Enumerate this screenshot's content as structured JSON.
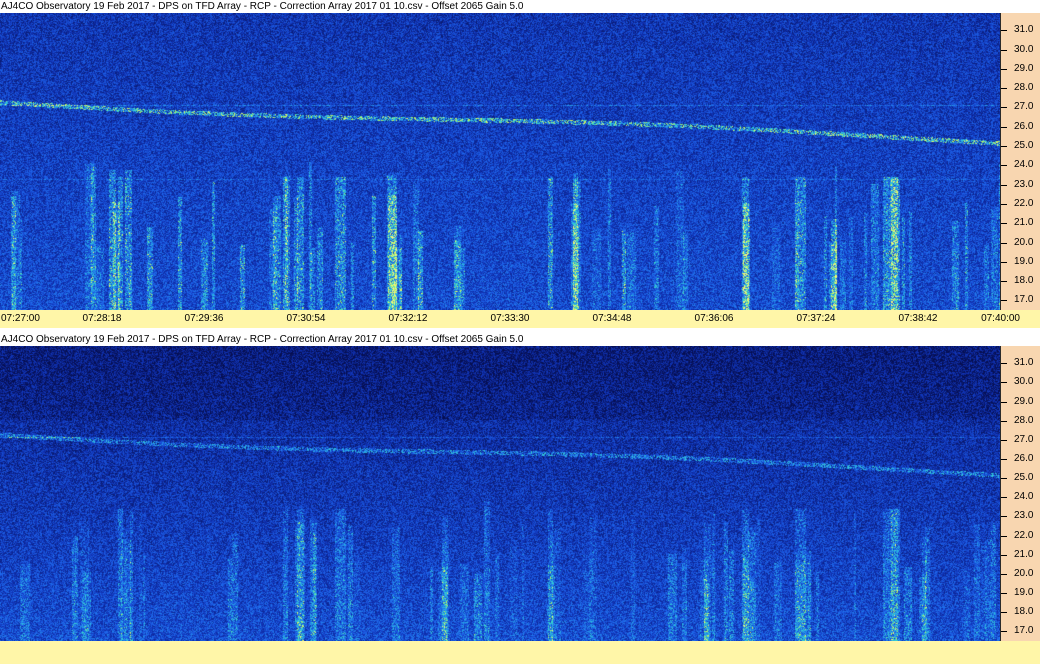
{
  "chart_data": [
    {
      "type": "heatmap",
      "title": "AJ4CO Observatory 19 Feb 2017  -  DPS on TFD Array  -  RCP  -  Correction Array 2017 01 10.csv  -  Offset 2065  Gain 5.0",
      "y_ticks": [
        "31.0",
        "30.0",
        "29.0",
        "28.0",
        "27.0",
        "26.0",
        "25.0",
        "24.0",
        "23.0",
        "22.0",
        "21.0",
        "20.0",
        "19.0",
        "18.0",
        "17.0"
      ],
      "ylim": [
        16.5,
        31.9
      ],
      "x_ticks": [
        "07:27:00",
        "07:28:18",
        "07:29:36",
        "07:30:54",
        "07:32:12",
        "07:33:30",
        "07:34:48",
        "07:36:06",
        "07:37:24",
        "07:38:42",
        "07:40:00"
      ],
      "xlim": [
        "07:27:00",
        "07:40:00"
      ],
      "colors": {
        "low": "#0a1a6e",
        "mid": "#1f5fe0",
        "high": "#2fd0d0",
        "peak": "#d8f040"
      }
    },
    {
      "type": "heatmap",
      "title": "AJ4CO Observatory 19 Feb 2017  -  DPS on TFD Array  -  RCP  -  Correction Array 2017 01 10.csv  -  Offset 2065  Gain 5.0",
      "y_ticks": [
        "31.0",
        "30.0",
        "29.0",
        "28.0",
        "27.0",
        "26.0",
        "25.0",
        "24.0",
        "23.0",
        "22.0",
        "21.0",
        "20.0",
        "19.0",
        "18.0",
        "17.0"
      ],
      "ylim": [
        16.5,
        31.9
      ],
      "x_ticks": [],
      "xlim": [
        "07:27:00",
        "07:40:00"
      ],
      "colors": {
        "low": "#0a1a6e",
        "mid": "#1f5fe0",
        "high": "#2fd0d0",
        "peak": "#d8f040"
      }
    }
  ]
}
